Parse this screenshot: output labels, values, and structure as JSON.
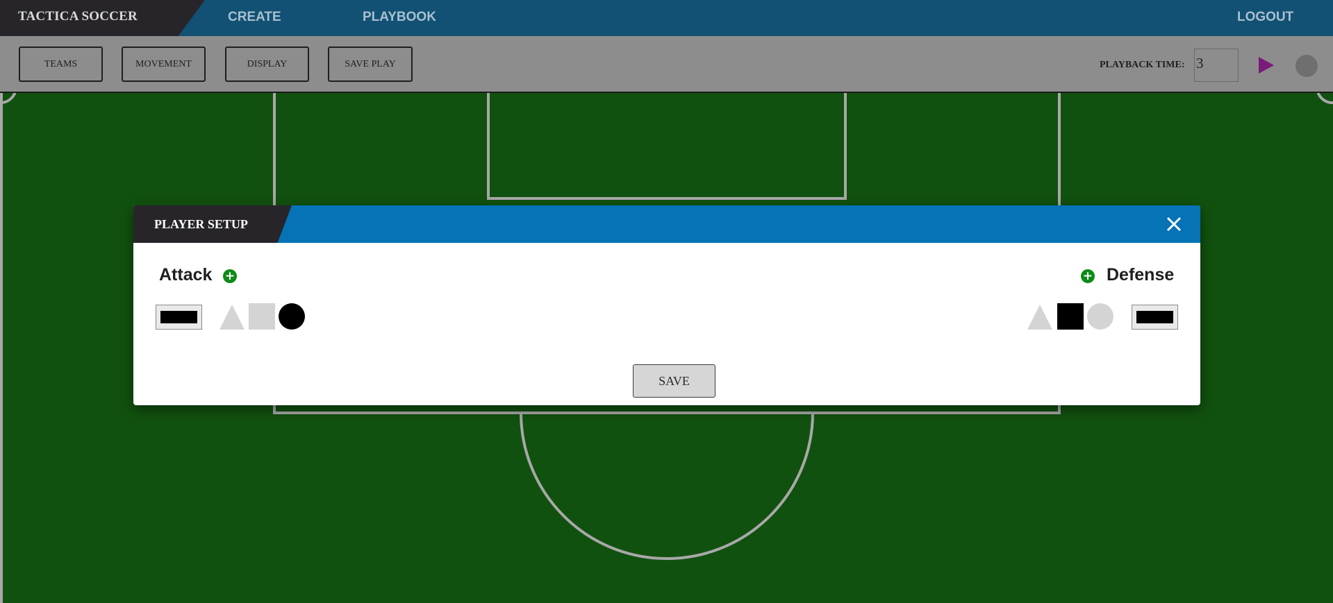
{
  "app": {
    "brand": "TACTICA SOCCER"
  },
  "nav": {
    "create": "CREATE",
    "playbook": "PLAYBOOK",
    "logout": "LOGOUT"
  },
  "toolbar": {
    "teams": "TEAMS",
    "movement": "MOVEMENT",
    "display": "DISPLAY",
    "save_play": "SAVE PLAY",
    "playback_label": "PLAYBACK TIME:",
    "playback_value": "3",
    "icons": {
      "play": "play-icon",
      "record": "record-icon"
    },
    "play_color": "#7a1a7a"
  },
  "modal": {
    "title": "PLAYER SETUP",
    "close_icon": "close-icon",
    "attack": {
      "title": "Attack",
      "add_icon": "plus-icon",
      "color": "#000000",
      "shapes": [
        {
          "shape": "triangle",
          "selected": false
        },
        {
          "shape": "square",
          "selected": false
        },
        {
          "shape": "circle",
          "selected": true
        }
      ]
    },
    "defense": {
      "title": "Defense",
      "add_icon": "plus-icon",
      "color": "#000000",
      "shapes": [
        {
          "shape": "triangle",
          "selected": false
        },
        {
          "shape": "square",
          "selected": true
        },
        {
          "shape": "circle",
          "selected": false
        }
      ]
    },
    "save": "SAVE"
  },
  "colors": {
    "nav_bg": "#125174",
    "brand_bg": "#27252a",
    "header_blue": "#0573b5",
    "pitch_green": "#11510f",
    "add_green": "#0e8a17",
    "unselected_shape": "#d4d4d4",
    "selected_shape": "#000000"
  }
}
